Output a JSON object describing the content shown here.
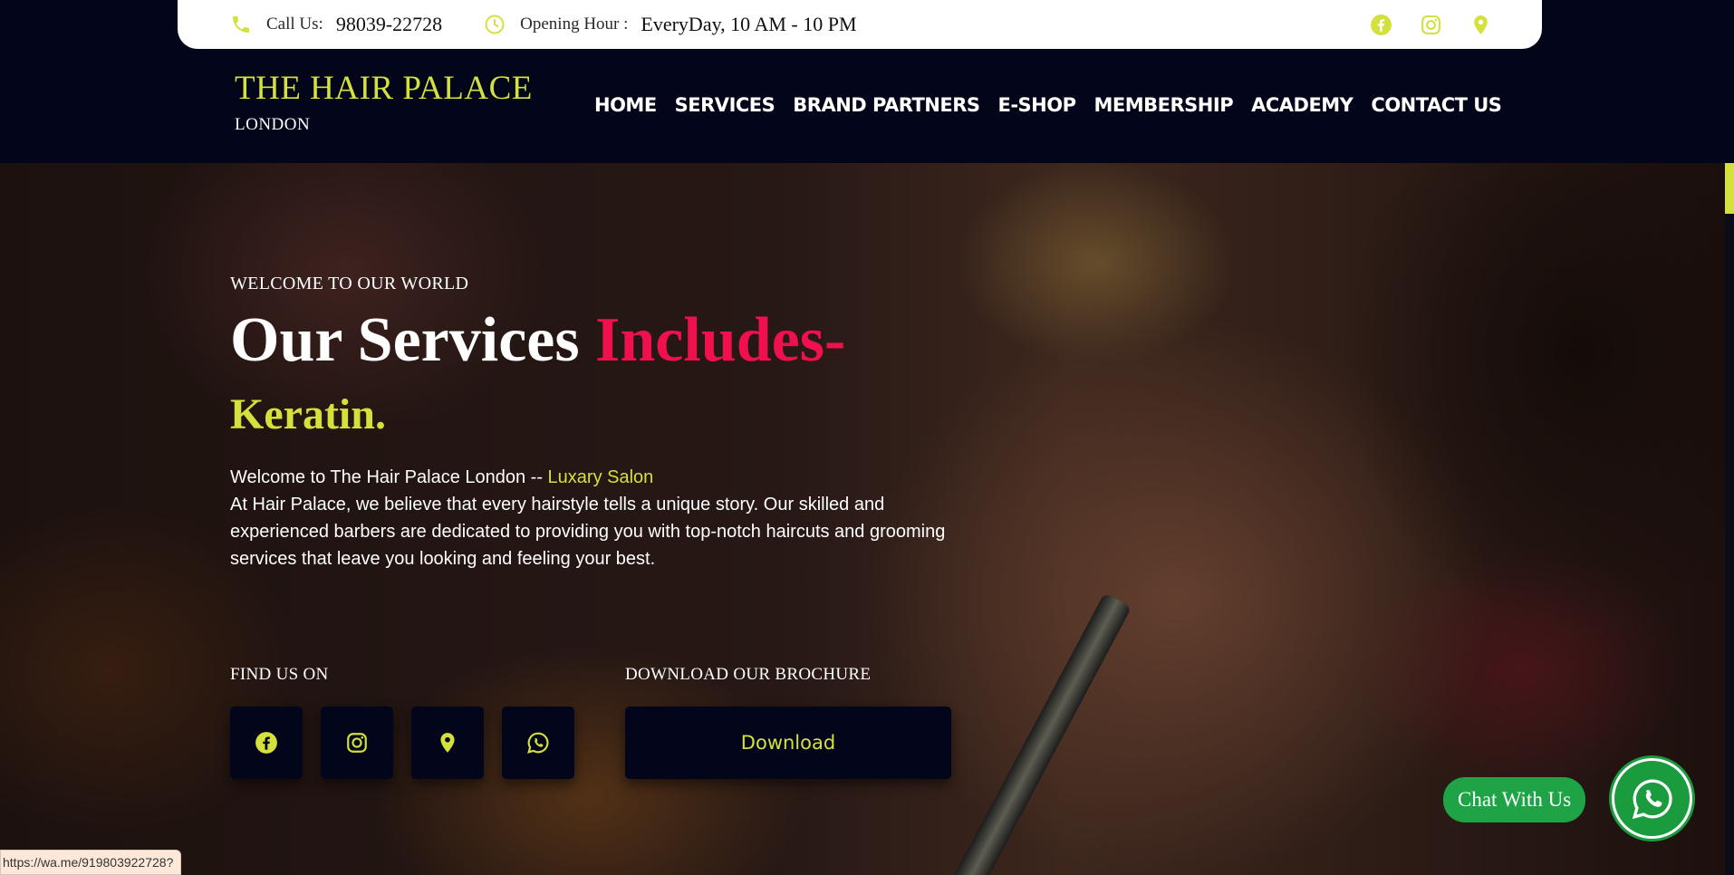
{
  "topbar": {
    "call_label": "Call Us:",
    "phone": "98039-22728",
    "hours_label": "Opening Hour :",
    "hours_value": "EveryDay, 10 AM - 10 PM",
    "icons": [
      "phone-icon",
      "clock-icon",
      "facebook-icon",
      "instagram-icon",
      "location-pin-icon"
    ]
  },
  "brand": {
    "name": "THE HAIR PALACE",
    "sub": "LONDON"
  },
  "nav": [
    "HOME",
    "SERVICES",
    "BRAND PARTNERS",
    "E-SHOP",
    "MEMBERSHIP",
    "ACADEMY",
    "CONTACT US"
  ],
  "hero": {
    "welcome": "WELCOME TO OUR WORLD",
    "title_main": "Our Services ",
    "title_highlight": "Includes-",
    "typed_word": "Keratin.",
    "intro_line": "Welcome to The Hair Palace London -- ",
    "intro_highlight": "Luxary Salon",
    "intro_body": "At Hair Palace, we believe that every hairstyle tells a unique story. Our skilled and experienced barbers are dedicated to providing you with top-notch haircuts and grooming services that leave you looking and feeling your best.",
    "find_us": "FIND US ON",
    "social_icons": [
      "facebook-icon",
      "instagram-icon",
      "location-pin-icon",
      "whatsapp-icon"
    ],
    "brochure_label": "DOWNLOAD OUR BROCHURE",
    "download_button": "Download"
  },
  "chat": {
    "label": "Chat With Us"
  },
  "status_url": "https://wa.me/919803922728?",
  "colors": {
    "accent": "#d4e03b",
    "highlight": "#f0104e",
    "dark": "#03061a",
    "whatsapp": "#1ea446"
  }
}
